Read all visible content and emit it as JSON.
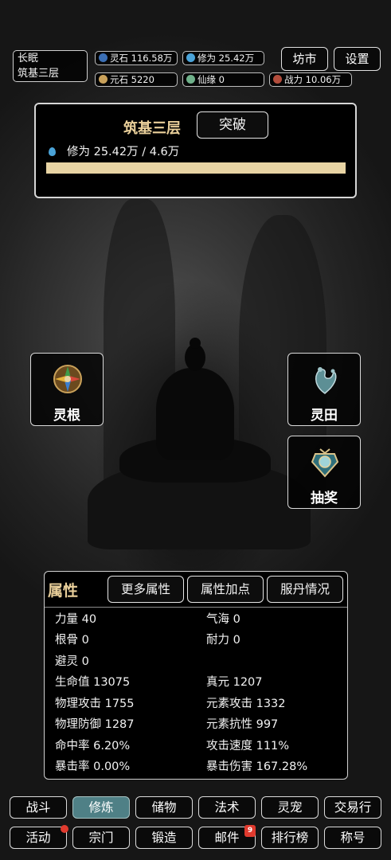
{
  "player": {
    "name": "长眠",
    "realm": "筑基三层"
  },
  "resources": {
    "lingshi": {
      "label": "灵石",
      "value": "116.58万"
    },
    "xiuwei": {
      "label": "修为",
      "value": "25.42万"
    },
    "yuanshi": {
      "label": "元石",
      "value": "5220"
    },
    "xianyuan": {
      "label": "仙缘",
      "value": "0"
    },
    "zhanli": {
      "label": "战力",
      "value": "10.06万"
    }
  },
  "top_buttons": {
    "market": "坊市",
    "settings": "设置"
  },
  "cultivation": {
    "realm": "筑基三层",
    "breakthrough": "突破",
    "label": "修为",
    "text": "25.42万 / 4.6万",
    "progress_fraction": 1.0
  },
  "side_buttons": {
    "linggen": "灵根",
    "lingtian": "灵田",
    "choujiang": "抽奖"
  },
  "attributes": {
    "title": "属性",
    "buttons": [
      "更多属性",
      "属性加点",
      "服丹情况"
    ],
    "left": [
      "力量 40",
      "根骨 0",
      "避灵 0",
      "生命值 13075",
      "物理攻击 1755",
      "物理防御 1287",
      "命中率 6.20%",
      "暴击率 0.00%"
    ],
    "right": [
      "气海 0",
      "耐力 0",
      "",
      "真元 1207",
      "元素攻击 1332",
      "元素抗性 997",
      "攻击速度 111%",
      "暴击伤害 167.28%"
    ]
  },
  "nav": {
    "row1": [
      "战斗",
      "修炼",
      "储物",
      "法术",
      "灵宠",
      "交易行"
    ],
    "row2": [
      "活动",
      "宗门",
      "锻造",
      "邮件",
      "排行榜",
      "称号"
    ],
    "mail_badge": "9",
    "active": "修炼"
  },
  "colors": {
    "gold_text": "#e9cf9a",
    "progress_fill": "#e8d4a4",
    "active_tab": "#4f8086",
    "badge_red": "#e03a2e",
    "water_drop": "#4aa3d8"
  }
}
